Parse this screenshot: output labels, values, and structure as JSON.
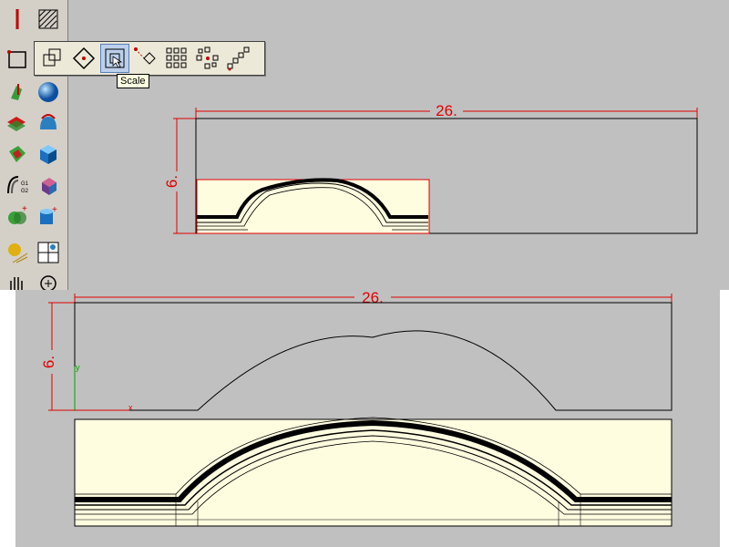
{
  "left_toolbar": {
    "tools": [
      "line-tool",
      "hatch-tool",
      "rectangle-tool",
      "extrude-tool",
      "sphere-tool",
      "planar-surface-tool",
      "revolve-tool",
      "loft-tool",
      "box-tool",
      "g1-g2-blend-tool",
      "solid-edit-tool",
      "boolean-tool",
      "cylinder-add-tool",
      "material-tool",
      "viewport-layout-tool",
      "pan-tool",
      "zoom-tool"
    ]
  },
  "flyout": {
    "tools": [
      "move",
      "rotate",
      "scale",
      "mirror",
      "array-rect",
      "array-polar",
      "array-curve"
    ],
    "active": "scale"
  },
  "tooltip": {
    "text": "Scale"
  },
  "top_view": {
    "width_dim": "26.",
    "height_dim": "6."
  },
  "bottom_view": {
    "width_dim": "26.",
    "height_dim": "6.",
    "axis_y": "y",
    "axis_x": "x"
  },
  "colors": {
    "dimension": "#e00000",
    "panel_fill": "#fffde0",
    "background": "#c0c0c0"
  }
}
